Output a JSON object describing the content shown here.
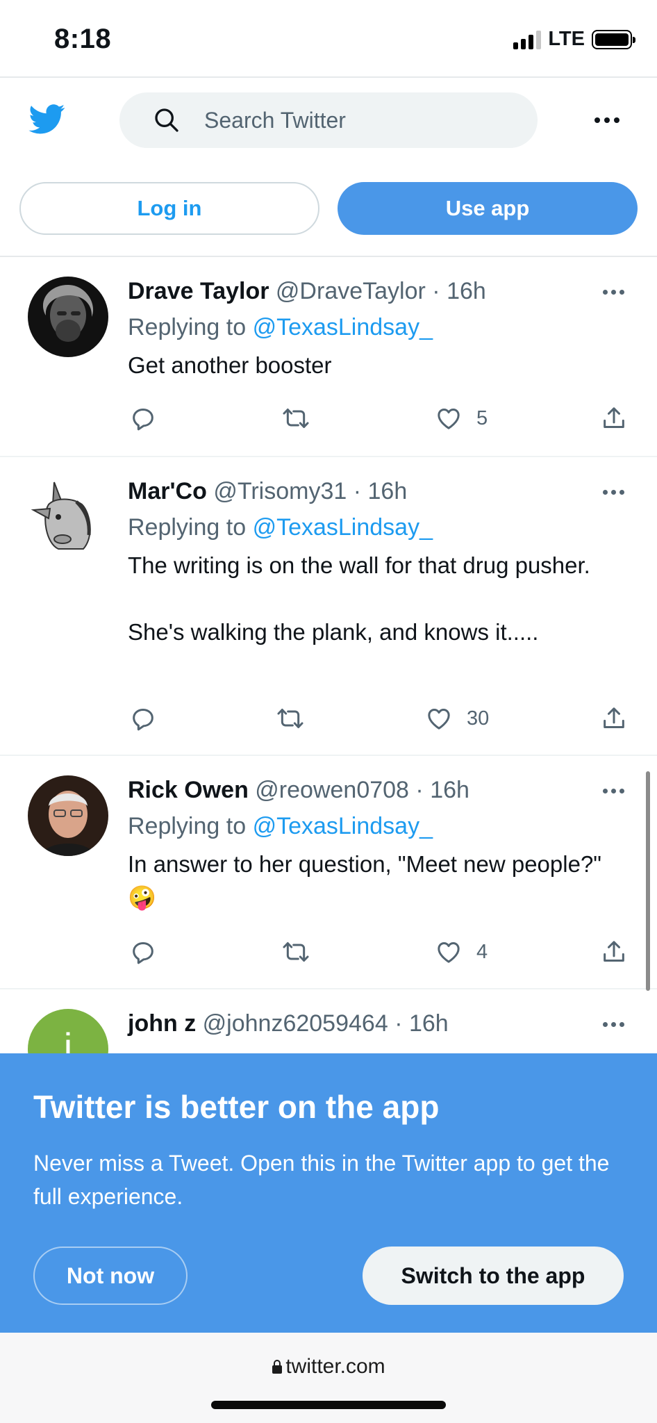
{
  "status_bar": {
    "time": "8:18",
    "network": "LTE"
  },
  "header": {
    "search_placeholder": "Search Twitter",
    "login_label": "Log in",
    "use_app_label": "Use app"
  },
  "tweets": [
    {
      "name": "Drave Taylor",
      "handle": "@DraveTaylor",
      "sep": "·",
      "time": "16h",
      "replying_prefix": "Replying to",
      "replying_to": "@TexasLindsay_",
      "text": "Get another booster",
      "likes": "5"
    },
    {
      "name": "Mar'Co",
      "handle": "@Trisomy31",
      "sep": "·",
      "time": "16h",
      "replying_prefix": "Replying to",
      "replying_to": "@TexasLindsay_",
      "text": "The writing is on the wall for that drug pusher.\n\nShe's walking the plank, and knows it.....",
      "likes": "30"
    },
    {
      "name": "Rick Owen",
      "handle": "@reowen0708",
      "sep": "·",
      "time": "16h",
      "replying_prefix": "Replying to",
      "replying_to": "@TexasLindsay_",
      "text": "In answer to her question, \"Meet new people?\" 🤪",
      "likes": "4"
    },
    {
      "name": "john z",
      "handle": "@johnz62059464",
      "sep": "·",
      "time": "16h",
      "avatar_letter": "j"
    }
  ],
  "banner": {
    "title": "Twitter is better on the app",
    "text": "Never miss a Tweet. Open this in the Twitter app to get the full experience.",
    "not_now_label": "Not now",
    "switch_label": "Switch to the app"
  },
  "browser": {
    "url": "twitter.com"
  },
  "colors": {
    "accent": "#1d9bf0",
    "banner": "#4a97e8",
    "secondary_text": "#536471"
  },
  "icons": [
    "twitter-bird-icon",
    "search-icon",
    "more-icon",
    "reply-icon",
    "retweet-icon",
    "like-icon",
    "share-icon",
    "lock-icon"
  ]
}
